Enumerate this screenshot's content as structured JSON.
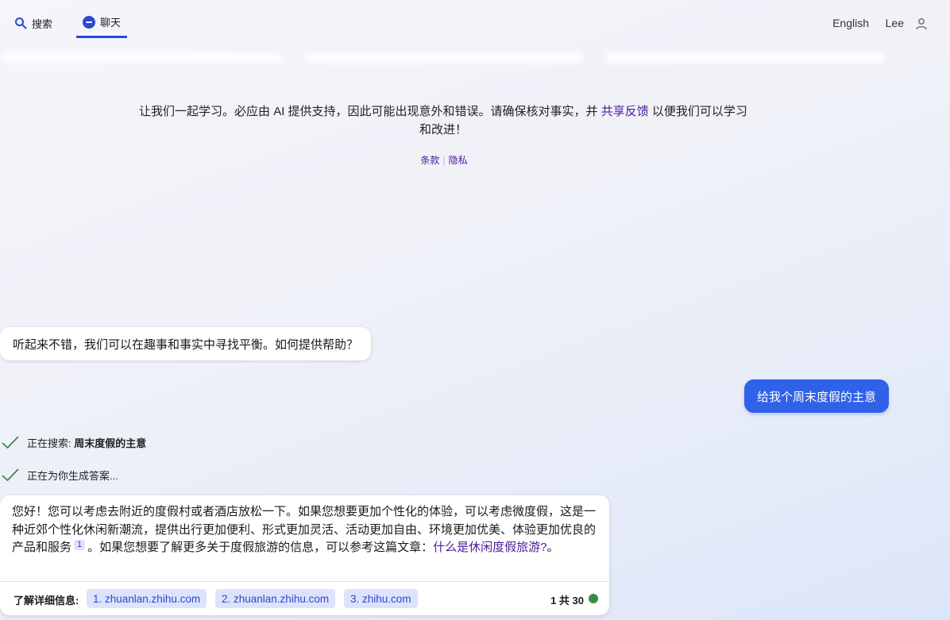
{
  "header": {
    "tabs": [
      {
        "label": "搜索",
        "icon": "search-icon"
      },
      {
        "label": "聊天",
        "icon": "chat-icon",
        "active": true
      }
    ],
    "language": "English",
    "user_name": "Lee",
    "accent_color": "#2b49d0"
  },
  "intro": {
    "text_before": "让我们一起学习。必应由 AI 提供支持，因此可能出现意外和错误。请确保核对事实，并",
    "link": "共享反馈",
    "text_after": "以便我们可以学习和改进！",
    "terms": "条款",
    "privacy": "隐私"
  },
  "conversation": {
    "bot_greeting": "听起来不错，我们可以在趣事和事实中寻找平衡。如何提供帮助？",
    "user_message": "给我个周末度假的主意",
    "status_search_label": "正在搜索: ",
    "status_search_query": "周末度假的主意",
    "status_generating": "正在为你生成答案...",
    "answer": {
      "part1": "您好！您可以考虑去附近的度假村或者酒店放松一下。如果您想要更加个性化的体验，可以考虑微度假，这是一种近郊个性化休闲新潮流，提供出行更加便利、形式更加灵活、活动更加自由、环境更加优美、体验更加优良的产品和服务",
      "citation": "1",
      "part2": "。如果您想要了解更多关于度假旅游的信息，可以参考这篇文章：",
      "link": "什么是休闲度假旅游?",
      "part3": "。"
    },
    "learn_more_label": "了解详细信息:",
    "sources": [
      "1. zhuanlan.zhihu.com",
      "2. zhuanlan.zhihu.com",
      "3. zhihu.com"
    ],
    "turn_count": "1 共 30",
    "turn_status_color": "#3a8a4a"
  }
}
